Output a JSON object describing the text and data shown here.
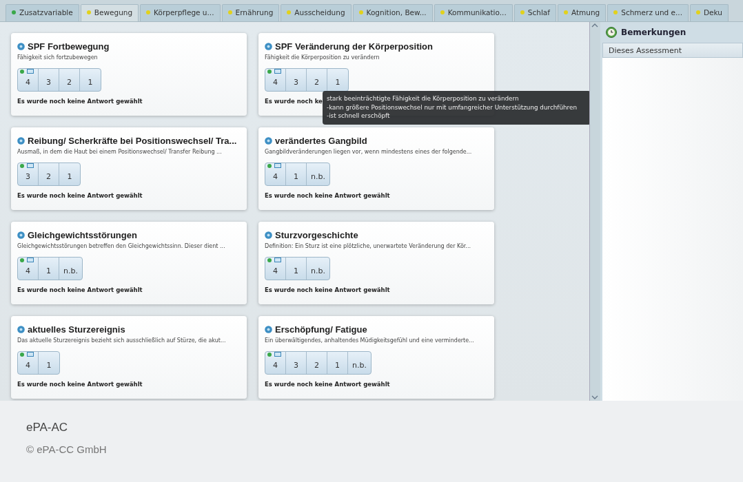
{
  "tabs": [
    {
      "label": "Zusatzvariable",
      "color": "#3aa84a",
      "selected": false
    },
    {
      "label": "Bewegung",
      "color": "#e2d21c",
      "selected": true
    },
    {
      "label": "Körperpflege u...",
      "color": "#e2d21c",
      "selected": false
    },
    {
      "label": "Ernährung",
      "color": "#e2d21c",
      "selected": false
    },
    {
      "label": "Ausscheidung",
      "color": "#e2d21c",
      "selected": false
    },
    {
      "label": "Kognition, Bew...",
      "color": "#e2d21c",
      "selected": false
    },
    {
      "label": "Kommunikatio...",
      "color": "#e2d21c",
      "selected": false
    },
    {
      "label": "Schlaf",
      "color": "#e2d21c",
      "selected": false
    },
    {
      "label": "Atmung",
      "color": "#e2d21c",
      "selected": false
    },
    {
      "label": "Schmerz und e...",
      "color": "#e2d21c",
      "selected": false
    },
    {
      "label": "Deku",
      "color": "#e2d21c",
      "selected": false
    }
  ],
  "items": [
    {
      "title": "SPF Fortbewegung",
      "description": "Fähigkeit sich fortzubewegen",
      "options": [
        "4",
        "3",
        "2",
        "1"
      ],
      "status": "Es wurde noch keine Antwort gewählt"
    },
    {
      "title": "SPF Veränderung der Körperposition",
      "description": "Fähigkeit die Körperposition zu verändern",
      "options": [
        "4",
        "3",
        "2",
        "1"
      ],
      "status": "Es wurde noch ke"
    },
    {
      "title": "Reibung/ Scherkräfte bei Positionswechsel/ Tra...",
      "description": "Ausmaß, in dem die Haut bei einem Positionswechsel/ Transfer Reibung ...",
      "options": [
        "3",
        "2",
        "1"
      ],
      "status": "Es wurde noch keine Antwort gewählt"
    },
    {
      "title": "verändertes Gangbild",
      "description": "Gangbildveränderungen liegen vor, wenn mindestens eines der folgende...",
      "options": [
        "4",
        "1",
        "n.b."
      ],
      "status": "Es wurde noch keine Antwort gewählt"
    },
    {
      "title": "Gleichgewichtsstörungen",
      "description": "Gleichgewichtsstörungen betreffen den Gleichgewichtssinn. Dieser dient ...",
      "options": [
        "4",
        "1",
        "n.b."
      ],
      "status": "Es wurde noch keine Antwort gewählt"
    },
    {
      "title": "Sturzvorgeschichte",
      "description": "Definition: Ein Sturz ist eine plötzliche, unerwartete Veränderung der Kör...",
      "options": [
        "4",
        "1",
        "n.b."
      ],
      "status": "Es wurde noch keine Antwort gewählt"
    },
    {
      "title": "aktuelles Sturzereignis",
      "description": "Das aktuelle Sturzereignis bezieht sich ausschließlich auf Stürze, die akut...",
      "options": [
        "4",
        "1"
      ],
      "status": "Es wurde noch keine Antwort gewählt"
    },
    {
      "title": "Erschöpfung/ Fatigue",
      "description": "Ein überwältigendes, anhaltendes Müdigkeitsgefühl und eine verminderte...",
      "options": [
        "4",
        "3",
        "2",
        "1",
        "n.b."
      ],
      "status": "Es wurde noch keine Antwort gewählt"
    }
  ],
  "tooltip": {
    "lines": [
      "stark beeinträchtigte Fähigkeit die Körperposition zu verändern",
      "-kann größere Positionswechsel nur mit umfangreicher Unterstützung durchführen",
      "-ist schnell erschöpft"
    ]
  },
  "remarks": {
    "title": "Bemerkungen",
    "section": "Dieses Assessment"
  },
  "caption": {
    "title": "ePA-AC",
    "credit": "© ePA-CC GmbH"
  }
}
